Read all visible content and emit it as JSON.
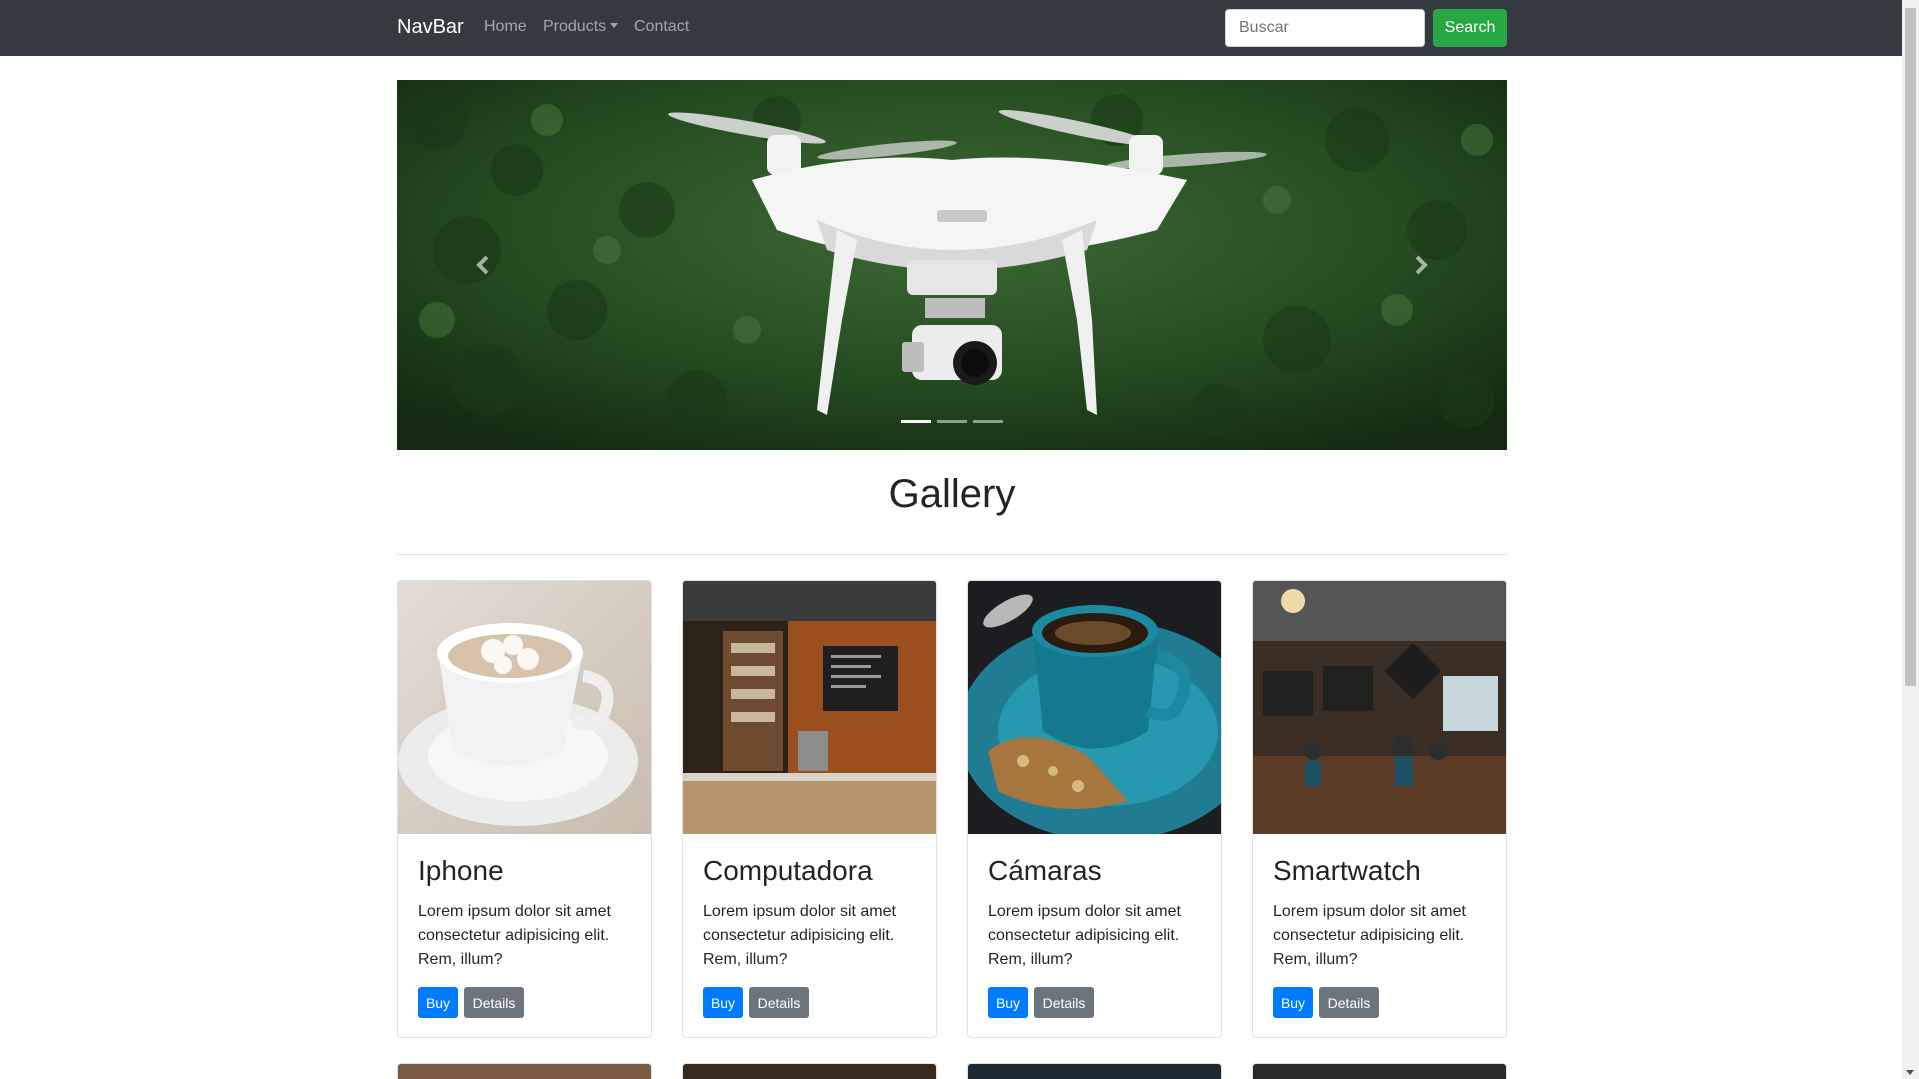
{
  "navbar": {
    "brand": "NavBar",
    "links": {
      "home": "Home",
      "products": "Products",
      "contact": "Contact"
    },
    "search": {
      "placeholder": "Buscar",
      "button": "Search"
    }
  },
  "carousel": {
    "indicators": 3,
    "active_index": 0
  },
  "gallery": {
    "title": "Gallery",
    "cards": [
      {
        "title": "Iphone",
        "text": "Lorem ipsum dolor sit amet consectetur adipisicing elit. Rem, illum?",
        "buy": "Buy",
        "details": "Details"
      },
      {
        "title": "Computadora",
        "text": "Lorem ipsum dolor sit amet consectetur adipisicing elit. Rem, illum?",
        "buy": "Buy",
        "details": "Details"
      },
      {
        "title": "Cámaras",
        "text": "Lorem ipsum dolor sit amet consectetur adipisicing elit. Rem, illum?",
        "buy": "Buy",
        "details": "Details"
      },
      {
        "title": "Smartwatch",
        "text": "Lorem ipsum dolor sit amet consectetur adipisicing elit. Rem, illum?",
        "buy": "Buy",
        "details": "Details"
      }
    ]
  },
  "colors": {
    "navbar": "#343a40",
    "search_button": "#28a745",
    "buy_button": "#007bff",
    "details_button": "#6c757d"
  }
}
